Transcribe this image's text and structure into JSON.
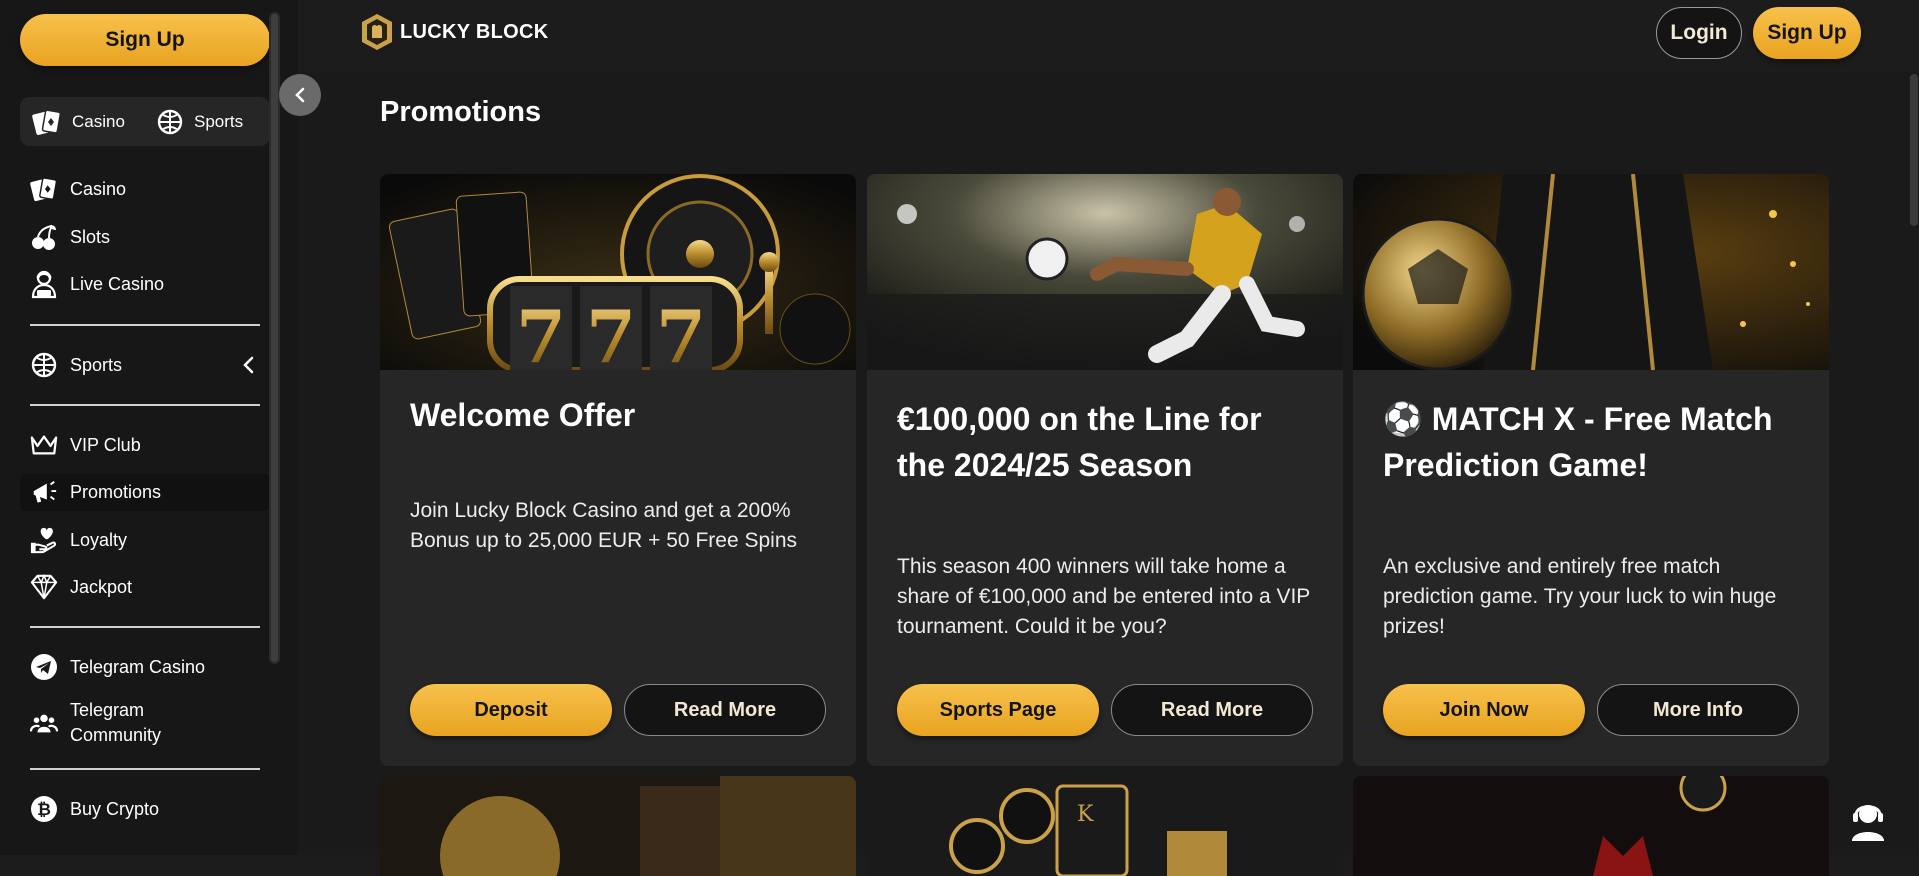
{
  "sidebar": {
    "signup_label": "Sign Up",
    "toggle": [
      {
        "label": "Casino",
        "icon": "cards-icon"
      },
      {
        "label": "Sports",
        "icon": "sports-ball-icon"
      }
    ],
    "items": [
      {
        "label": "Casino",
        "icon": "cards-icon"
      },
      {
        "label": "Slots",
        "icon": "cherries-icon"
      },
      {
        "label": "Live Casino",
        "icon": "live-dealer-icon"
      },
      {
        "label": "Sports",
        "icon": "sports-ball-icon"
      },
      {
        "label": "VIP Club",
        "icon": "crown-icon"
      },
      {
        "label": "Promotions",
        "icon": "megaphone-icon"
      },
      {
        "label": "Loyalty",
        "icon": "heart-hand-icon"
      },
      {
        "label": "Jackpot",
        "icon": "diamond-icon"
      },
      {
        "label": "Telegram Casino",
        "icon": "telegram-icon"
      },
      {
        "label": "Telegram Community",
        "icon": "people-icon"
      },
      {
        "label": "Buy Crypto",
        "icon": "bitcoin-icon"
      }
    ],
    "active_item": "Promotions"
  },
  "header": {
    "logo_text": "LUCKY BLOCK",
    "login_label": "Login",
    "signup_label": "Sign Up"
  },
  "main": {
    "title": "Promotions",
    "cards": [
      {
        "title": "Welcome Offer",
        "description": "Join Lucky Block Casino and get a 200% Bonus up to 25,000 EUR + 50 Free Spins",
        "primary_button": "Deposit",
        "secondary_button": "Read More",
        "image": "casino-slot-777-image"
      },
      {
        "title": "€100,000 on the Line for the 2024/25 Season",
        "description": "This season 400 winners will take home a share of €100,000 and be entered into a VIP tournament. Could it be you?",
        "primary_button": "Sports Page",
        "secondary_button": "Read More",
        "image": "football-player-kick-image"
      },
      {
        "title": "⚽ MATCH X - Free Match Prediction Game!",
        "description": "An exclusive and entirely free match prediction game. Try your luck to win huge prizes!",
        "primary_button": "Join Now",
        "secondary_button": "More Info",
        "image": "golden-football-player-image"
      }
    ]
  },
  "colors": {
    "accent_gold": "#f2b22f",
    "background": "#1c1c1c",
    "card": "#262626",
    "sidebar": "#171717"
  }
}
